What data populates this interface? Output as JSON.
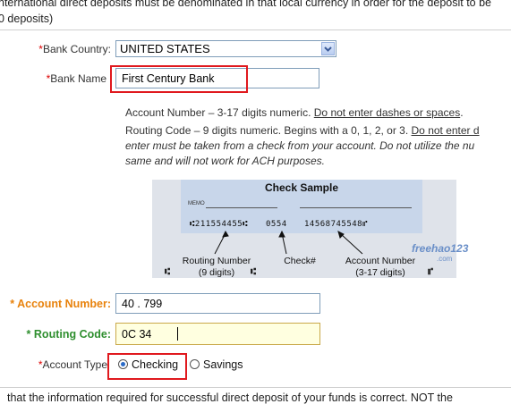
{
  "intro": {
    "line1": "nternational direct deposits must be denominated in that local currency in order for the deposit to be",
    "line2": "0 deposits)"
  },
  "bank_country": {
    "required_mark": "*",
    "label": "Bank Country:",
    "value": "UNITED STATES"
  },
  "bank_name": {
    "required_mark": "*",
    "label": "Bank Name",
    "value": "First Century Bank"
  },
  "help": {
    "account_prefix": "Account Number – 3-17 digits numeric. ",
    "account_link": "Do not enter dashes or spaces",
    "account_suffix": ".",
    "routing_prefix": "Routing Code – 9 digits numeric. Begins with a 0, 1, 2, or 3. ",
    "routing_link": "Do not enter d",
    "italic_line1": "enter must be taken from a check from your account. Do not utilize the nu",
    "italic_line2": "same and will not work for ACH purposes."
  },
  "check_sample": {
    "title": "Check Sample",
    "memo": "MEMO",
    "micr_routing": "⑆211554455⑆",
    "micr_check": "0554",
    "micr_account": "14568745548⑈",
    "routing_label1": "Routing Number",
    "routing_label2": "(9 digits)",
    "check_label": "Check#",
    "account_label1": "Account Number",
    "account_label2": "(3-17 digits)",
    "watermark": "freehao123",
    "watermark_sub": ".com"
  },
  "account_number": {
    "required_mark": "*",
    "label": "Account Number:",
    "value": "40 .            799"
  },
  "routing_code": {
    "required_mark": "*",
    "label": "Routing Code:",
    "value": "0C        34"
  },
  "account_type": {
    "required_mark": "*",
    "label": "Account Type",
    "options": [
      "Checking",
      "Savings"
    ],
    "selected": "Checking"
  },
  "footer": {
    "text": "that the information required for successful direct deposit of your funds is correct. NOT the"
  },
  "colors": {
    "orange_label": "#e8820c",
    "green_label": "#2f8f2f",
    "highlight": "#e0191e",
    "routing_bg": "#ffffe0"
  }
}
